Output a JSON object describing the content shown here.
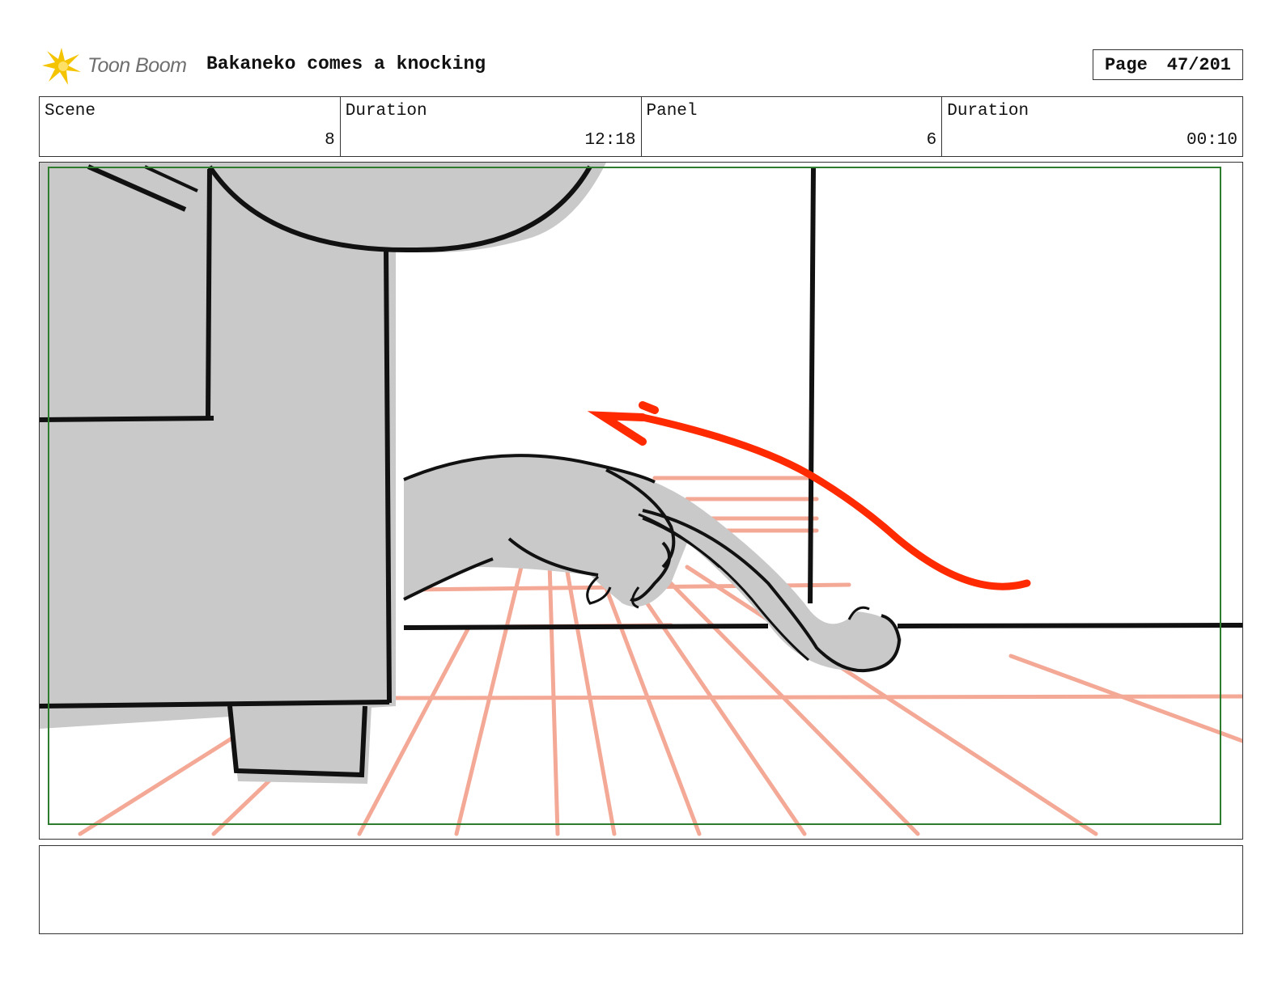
{
  "header": {
    "logo_text": "Toon Boom",
    "title": "Bakaneko comes a knocking",
    "page_label": "Page",
    "page_value": "47/201"
  },
  "info": {
    "scene_label": "Scene",
    "scene_value": "8",
    "scene_duration_label": "Duration",
    "scene_duration_value": "12:18",
    "panel_label": "Panel",
    "panel_value": "6",
    "panel_duration_label": "Duration",
    "panel_duration_value": "00:10"
  },
  "colors": {
    "accent_arrow": "#ff2a00",
    "floor_lines": "#f4a896",
    "safe_frame": "#2e7d2e",
    "fill_gray": "#c9c9c9",
    "logo_star": "#f5c400"
  },
  "notes": {
    "text": ""
  }
}
